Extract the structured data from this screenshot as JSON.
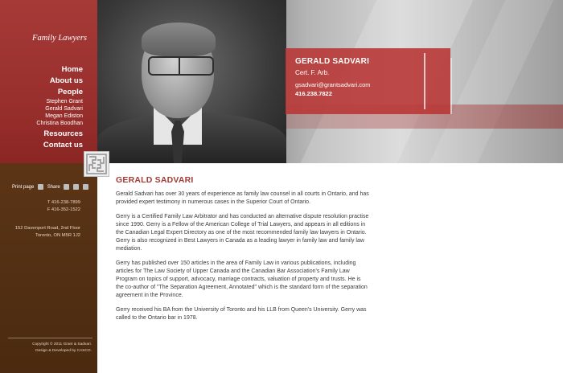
{
  "brand": "Family Lawyers",
  "nav": {
    "home": "Home",
    "about": "About us",
    "people": "People",
    "people_sub": [
      "Stephen Grant",
      "Gerald Sadvari",
      "Megan Ediston",
      "Christina Boodhan"
    ],
    "resources": "Resources",
    "contact": "Contact us"
  },
  "profile": {
    "name": "GERALD SADVARI",
    "credential": "Cert. F. Arb.",
    "email": "gsadvari@grantsadvari.com",
    "phone": "416.238.7822"
  },
  "tools": {
    "print": "Print page",
    "share": "Share"
  },
  "contact": {
    "tel": "T 416-238-7899",
    "fax": "F 416-352-1522",
    "address1": "152 Davenport Road, 2nd Floor",
    "address2": "Toronto, ON M5R 1J2"
  },
  "footer": {
    "copyright": "Copyright © 2011 Grant & Sadvari.",
    "credit": "Design & Developed by CASCO."
  },
  "content": {
    "title": "GERALD SADVARI",
    "paragraphs": [
      "Gerald Sadvari has over 30 years of experience as family law counsel in all courts in Ontario, and has provided expert testimony in numerous cases in the Superior Court of Ontario.",
      "Gerry is a Certified Family Law Arbitrator and has conducted an alternative dispute resolution practise since 1990. Gerry is a Fellow of the American College of Trial Lawyers, and appears in all editions in the Canadian Legal Expert Directory as one of the most recommended family law lawyers in Ontario. Gerry is also recognized in Best Lawyers in Canada as a leading lawyer in family law and family law mediation.",
      "Gerry has published over 150 articles in the area of Family Law in various publications, including articles for The Law Society of Upper Canada and the Canadian Bar Association's Family Law Program on topics of support, advocacy, marriage contracts, valuation of property and trusts. He is the co-author of \"The Separation Agreement, Annotated\" which is the standard form of the separation agreement in the Province.",
      "Gerry received his BA from the University of Toronto and his LLB from Queen's University. Gerry was called to the Ontario bar in 1978."
    ]
  },
  "colors": {
    "brand_red": "#a33a36",
    "sidebar_brown": "#4f2d12"
  },
  "icons": [
    "print-icon",
    "linkedin-icon",
    "twitter-icon",
    "facebook-icon"
  ]
}
